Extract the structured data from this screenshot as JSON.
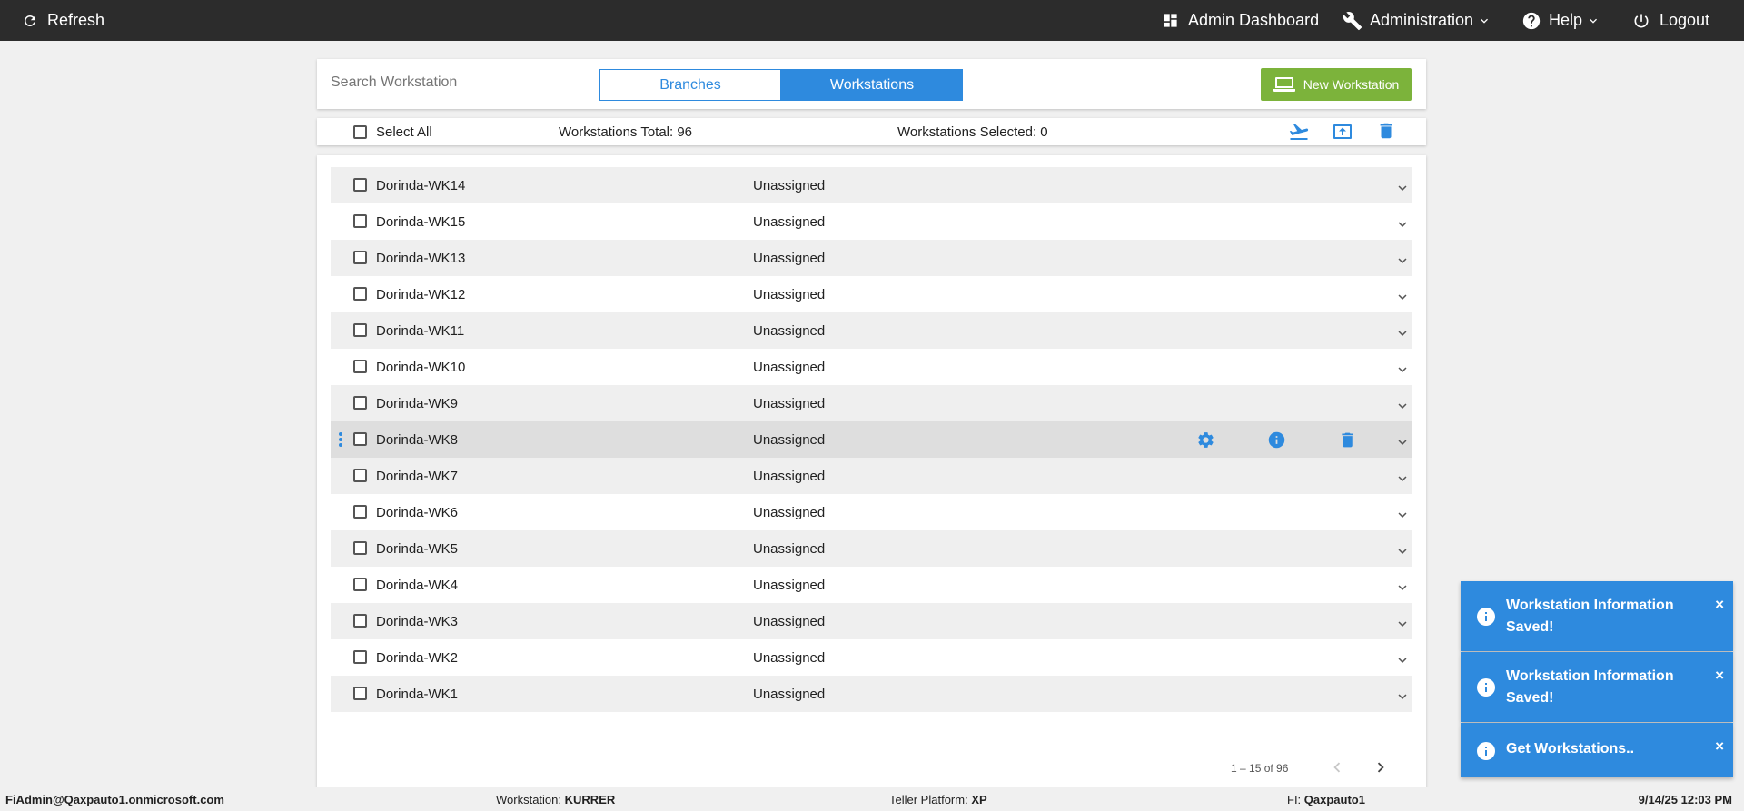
{
  "topbar": {
    "refresh_label": "Refresh",
    "dashboard_label": "Admin Dashboard",
    "administration_label": "Administration",
    "help_label": "Help",
    "logout_label": "Logout"
  },
  "header": {
    "search_placeholder": "Search Workstation",
    "tab_branches": "Branches",
    "tab_workstations": "Workstations",
    "active_tab": "Workstations",
    "new_button_label": "New Workstation"
  },
  "toolbar": {
    "select_all_label": "Select All",
    "total_label": "Workstations Total: 96",
    "selected_label": "Workstations Selected: 0"
  },
  "rows": [
    {
      "name": "Dorinda-WK14",
      "assignment": "Unassigned"
    },
    {
      "name": "Dorinda-WK15",
      "assignment": "Unassigned"
    },
    {
      "name": "Dorinda-WK13",
      "assignment": "Unassigned"
    },
    {
      "name": "Dorinda-WK12",
      "assignment": "Unassigned"
    },
    {
      "name": "Dorinda-WK11",
      "assignment": "Unassigned"
    },
    {
      "name": "Dorinda-WK10",
      "assignment": "Unassigned"
    },
    {
      "name": "Dorinda-WK9",
      "assignment": "Unassigned"
    },
    {
      "name": "Dorinda-WK8",
      "assignment": "Unassigned"
    },
    {
      "name": "Dorinda-WK7",
      "assignment": "Unassigned"
    },
    {
      "name": "Dorinda-WK6",
      "assignment": "Unassigned"
    },
    {
      "name": "Dorinda-WK5",
      "assignment": "Unassigned"
    },
    {
      "name": "Dorinda-WK4",
      "assignment": "Unassigned"
    },
    {
      "name": "Dorinda-WK3",
      "assignment": "Unassigned"
    },
    {
      "name": "Dorinda-WK2",
      "assignment": "Unassigned"
    },
    {
      "name": "Dorinda-WK1",
      "assignment": "Unassigned"
    }
  ],
  "pagination": {
    "range_label": "1 – 15 of 96"
  },
  "toasts": [
    {
      "message": "Workstation Information Saved!",
      "close": "×"
    },
    {
      "message": "Workstation Information Saved!",
      "close": "×"
    },
    {
      "message": "Get Workstations..",
      "close": "×"
    }
  ],
  "statusbar": {
    "user": "FiAdmin@Qaxpauto1.onmicrosoft.com",
    "workstation_label": "Workstation:",
    "workstation_value": "KURRER",
    "platform_label": "Teller Platform:",
    "platform_value": "XP",
    "fi_label": "FI:",
    "fi_value": "Qaxpauto1",
    "datetime": "9/14/25 12:03 PM"
  },
  "colors": {
    "accent": "#2e8ade",
    "new_button": "#7cb33b",
    "topbar": "#2c2c2c"
  }
}
